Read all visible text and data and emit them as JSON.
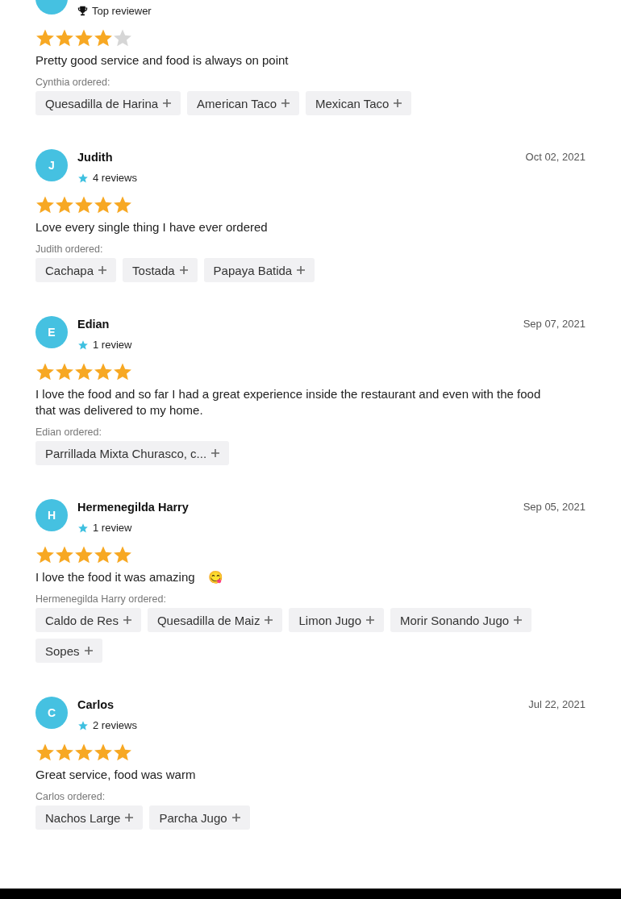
{
  "reviews": [
    {
      "badge": {
        "kind": "top_reviewer",
        "text": "Top reviewer"
      },
      "stars": 4,
      "text": "Pretty good service and food is always on point",
      "ordered_label": "Cynthia ordered:",
      "items": [
        "Quesadilla de Harina",
        "American Taco",
        "Mexican Taco"
      ]
    },
    {
      "avatar": "J",
      "name": "Judith",
      "date": "Oct 02, 2021",
      "badge": {
        "kind": "reviews",
        "text": "4 reviews"
      },
      "stars": 5,
      "text": "Love every single thing I have ever ordered",
      "ordered_label": "Judith ordered:",
      "items": [
        "Cachapa",
        "Tostada",
        "Papaya Batida"
      ]
    },
    {
      "avatar": "E",
      "name": "Edian",
      "date": "Sep 07, 2021",
      "badge": {
        "kind": "reviews",
        "text": "1 review"
      },
      "stars": 5,
      "text": "I love the food and so far I had a great experience inside the restaurant and even with the food that was delivered to my home.",
      "ordered_label": "Edian ordered:",
      "items": [
        "Parrillada Mixta Churasco, c..."
      ]
    },
    {
      "avatar": "H",
      "name": "Hermenegilda Harry",
      "date": "Sep 05, 2021",
      "badge": {
        "kind": "reviews",
        "text": "1 review"
      },
      "stars": 5,
      "text": "I love the food it was amazing    😋",
      "ordered_label": "Hermenegilda Harry ordered:",
      "items": [
        "Caldo de Res",
        "Quesadilla de Maiz",
        "Limon Jugo",
        "Morir Sonando Jugo",
        "Sopes"
      ]
    },
    {
      "avatar": "C",
      "name": "Carlos",
      "date": "Jul 22, 2021",
      "badge": {
        "kind": "reviews",
        "text": "2 reviews"
      },
      "stars": 5,
      "text": "Great service, food was warm",
      "ordered_label": "Carlos ordered:",
      "items": [
        "Nachos Large",
        "Parcha Jugo"
      ]
    }
  ]
}
